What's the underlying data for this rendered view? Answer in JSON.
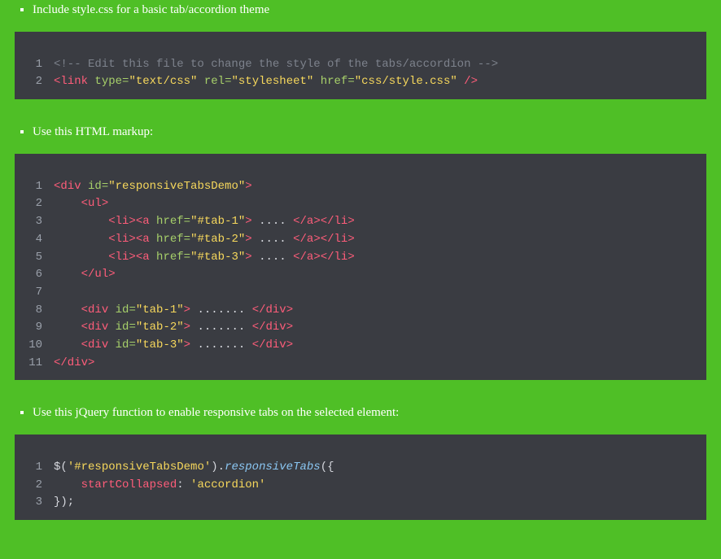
{
  "notes": {
    "n1": "Include style.css for a basic tab/accordion theme",
    "n2": "Use this HTML markup:",
    "n3": "Use this jQuery function to enable responsive tabs on the selected element:"
  },
  "code1": {
    "l1_comment": "<!-- Edit this file to change the style of the tabs/accordion -->",
    "l2_tag_open": "<link",
    "l2_attr_type": "type",
    "l2_val_type": "\"text/css\"",
    "l2_attr_rel": "rel",
    "l2_val_rel": "\"stylesheet\"",
    "l2_attr_href": "href",
    "l2_val_href": "\"css/style.css\"",
    "l2_tag_close": "/>"
  },
  "code2": {
    "open_div": "<div",
    "id_attr": "id",
    "id_val_demo": "\"responsiveTabsDemo\"",
    "close_br": ">",
    "open_ul": "<ul>",
    "li_open": "<li>",
    "a_open": "<a",
    "href_attr": "href",
    "href1": "\"#tab-1\"",
    "href2": "\"#tab-2\"",
    "href3": "\"#tab-3\"",
    "dots4": " .... ",
    "a_close": "</a>",
    "li_close": "</li>",
    "close_ul": "</ul>",
    "div_open": "<div",
    "id_tab1": "\"tab-1\"",
    "id_tab2": "\"tab-2\"",
    "id_tab3": "\"tab-3\"",
    "dots7": " ....... ",
    "div_close": "</div>",
    "final_close": "</div>"
  },
  "code3": {
    "jq": "$(",
    "sel": "'#responsiveTabsDemo'",
    "paren_dot": ").",
    "fn": "responsiveTabs",
    "open": "({",
    "key": "startCollapsed",
    "colon": ": ",
    "val": "'accordion'",
    "close": "});"
  },
  "ln": {
    "_1": "1",
    "_2": "2",
    "_3": "3",
    "_4": "4",
    "_5": "5",
    "_6": "6",
    "_7": "7",
    "_8": "8",
    "_9": "9",
    "_10": "10",
    "_11": "11"
  }
}
